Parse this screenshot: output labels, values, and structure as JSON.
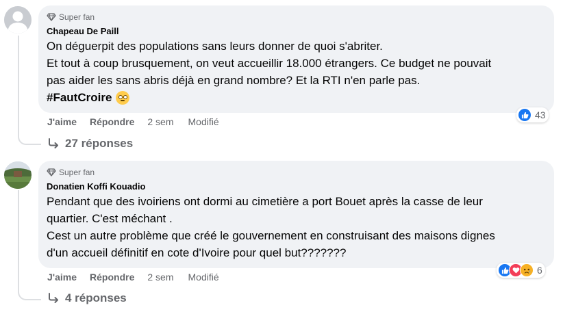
{
  "colors": {
    "like_blue": "#1877f2",
    "love_red": "#f33e58",
    "sad_yellow": "#f7b125",
    "bubble_bg": "#f0f2f5"
  },
  "comments": [
    {
      "badge": "Super fan",
      "author": "Chapeau De Paill",
      "text": "On déguerpit des populations sans leurs donner de quoi s'abriter.\nEt tout à coup brusquement, on veut accueillir 18.000 étrangers. Ce budget ne pouvait\npas aider les sans abris déjà en grand nombre? Et la RTI n'en parle pas.",
      "hashtag": "#FautCroire",
      "hashtag_emoji": "face-with-rolling-eyes",
      "like_label": "J'aime",
      "reply_label": "Répondre",
      "time": "2 sem",
      "edited": "Modifié",
      "reaction_count": "43",
      "reaction_icons": [
        "like-icon"
      ],
      "replies_label": "27 réponses"
    },
    {
      "badge": "Super fan",
      "author": "Donatien Koffi Kouadio",
      "text": "Pendant que des ivoiriens ont dormi au cimetière a port Bouet après la casse de leur\nquartier. C'est méchant .\nCest un autre problème que créé le gouvernement en construisant des maisons dignes\nd'un accueil définitif en cote d'Ivoire pour quel but???????",
      "like_label": "J'aime",
      "reply_label": "Répondre",
      "time": "2 sem",
      "edited": "Modifié",
      "reaction_count": "6",
      "reaction_icons": [
        "like-icon",
        "love-icon",
        "sad-icon"
      ],
      "replies_label": "4 réponses"
    }
  ]
}
